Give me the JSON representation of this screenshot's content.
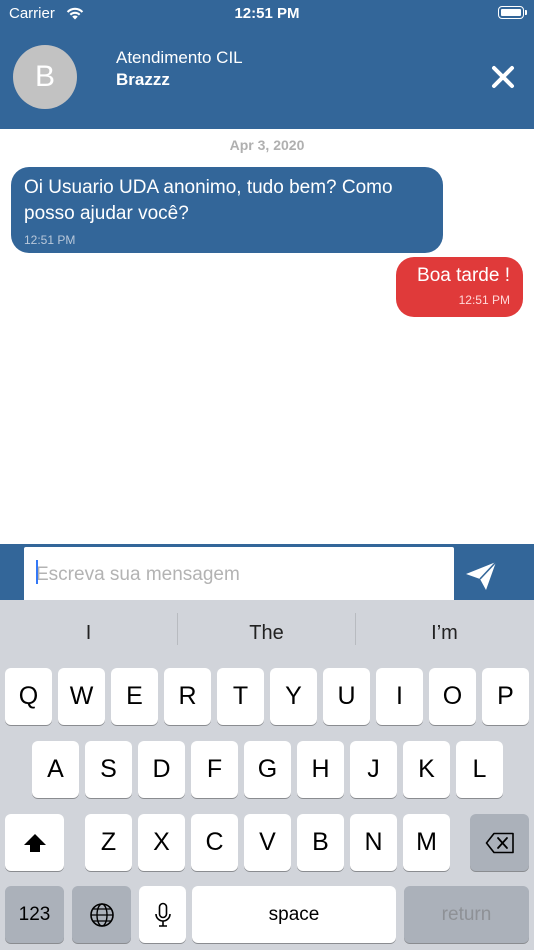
{
  "status_bar": {
    "carrier": "Carrier",
    "time": "12:51 PM"
  },
  "header": {
    "avatar_initial": "B",
    "title": "Atendimento CIL",
    "name": "Brazzz"
  },
  "conversation": {
    "date": "Apr 3, 2020",
    "messages": [
      {
        "direction": "incoming",
        "text": "Oi Usuario UDA anonimo, tudo bem? Como posso ajudar você?",
        "time": "12:51 PM"
      },
      {
        "direction": "outgoing",
        "text": "Boa tarde !",
        "time": "12:51 PM"
      }
    ]
  },
  "composer": {
    "placeholder": "Escreva sua mensagem"
  },
  "keyboard": {
    "suggestions": [
      "I",
      "The",
      "I’m"
    ],
    "row1": [
      "Q",
      "W",
      "E",
      "R",
      "T",
      "Y",
      "U",
      "I",
      "O",
      "P"
    ],
    "row2": [
      "A",
      "S",
      "D",
      "F",
      "G",
      "H",
      "J",
      "K",
      "L"
    ],
    "row3": [
      "Z",
      "X",
      "C",
      "V",
      "B",
      "N",
      "M"
    ],
    "numbers_label": "123",
    "space_label": "space",
    "return_label": "return"
  },
  "colors": {
    "brand_blue": "#336699",
    "outgoing_red": "#e03a3a",
    "keyboard_bg": "#d1d4da"
  }
}
